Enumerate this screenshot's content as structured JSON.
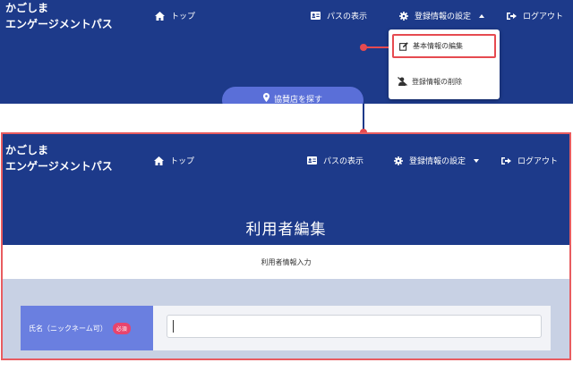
{
  "brand": {
    "line1": "かごしま",
    "line2": "エンゲージメントパス"
  },
  "nav": {
    "top": "トップ",
    "pass": "パスの表示",
    "settings": "登録情報の設定",
    "logout": "ログアウト"
  },
  "search": {
    "label": "協賛店を探す"
  },
  "dropdown": {
    "edit": "基本情報の編集",
    "delete": "登録情報の削除"
  },
  "page": {
    "title": "利用者編集",
    "subtitle": "利用者情報入力"
  },
  "form": {
    "name_label": "氏名（ニックネーム可）",
    "required": "必須",
    "name_value": ""
  },
  "colors": {
    "header": "#1d3a8a",
    "accent_red": "#e64a50",
    "label_bg": "#6a7fe0",
    "badge": "#e8446d"
  }
}
